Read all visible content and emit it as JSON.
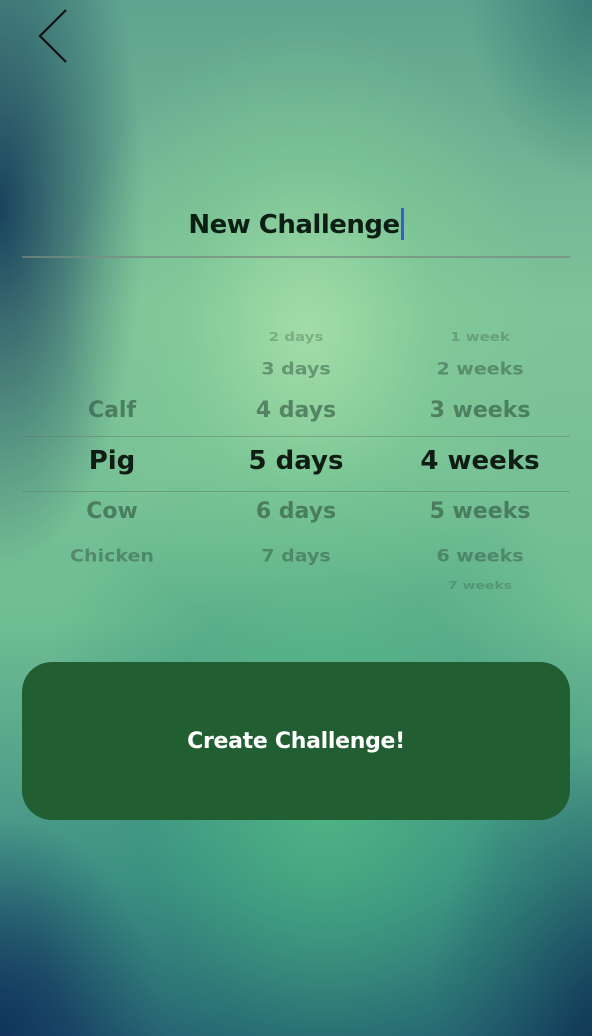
{
  "nav": {
    "back_icon": "chevron-left-icon"
  },
  "title": {
    "text": "New Challenge"
  },
  "picker": {
    "animals": {
      "above": [
        "Calf"
      ],
      "selected": "Pig",
      "below": [
        "Cow",
        "Chicken"
      ]
    },
    "days": {
      "above": [
        "2 days",
        "3 days",
        "4 days"
      ],
      "selected": "5 days",
      "below": [
        "6 days",
        "7 days"
      ]
    },
    "weeks": {
      "above": [
        "1 week",
        "2 weeks",
        "3 weeks"
      ],
      "selected": "4 weeks",
      "below": [
        "5 weeks",
        "6 weeks",
        "7 weeks"
      ]
    }
  },
  "actions": {
    "create_label": "Create Challenge!"
  },
  "colors": {
    "button_bg": "#215f33",
    "cursor": "#3b5bd6"
  }
}
